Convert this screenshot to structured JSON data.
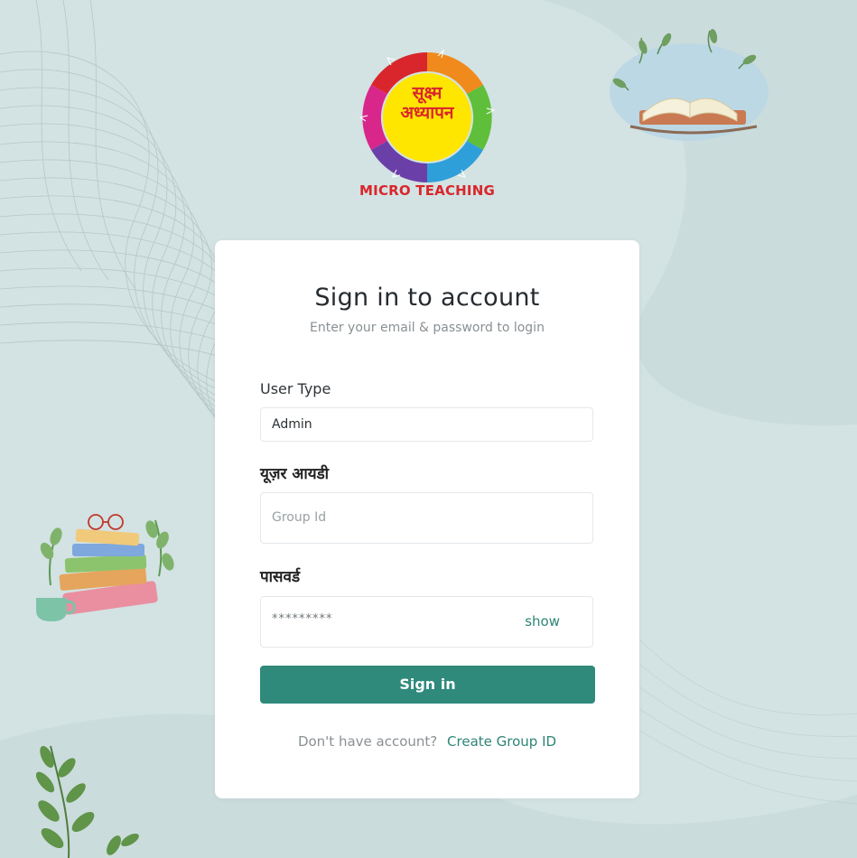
{
  "brand": {
    "logo_center_line1": "सूक्ष्म",
    "logo_center_line2": "अध्यापन",
    "caption": "MICRO TEACHING",
    "colors": {
      "red": "#d9262c",
      "orange": "#f08a1c",
      "green": "#5fbf3a",
      "blue": "#2f9fd9",
      "purple": "#6b3fa8",
      "magenta": "#d9268b",
      "yellow": "#ffe600"
    }
  },
  "card": {
    "title": "Sign in to account",
    "subtitle": "Enter your email & password to login"
  },
  "form": {
    "user_type": {
      "label": "User Type",
      "value": "Admin"
    },
    "user_id": {
      "label": "यूज़र आयडी",
      "placeholder": "Group Id"
    },
    "password": {
      "label": "पासवर्ड",
      "masked_value": "*********",
      "toggle_label": "show"
    },
    "submit_label": "Sign in"
  },
  "footer": {
    "prompt": "Don't have account?",
    "link_label": "Create Group ID"
  },
  "theme": {
    "background": "#d3e2e2",
    "accent": "#2f8a7c"
  }
}
